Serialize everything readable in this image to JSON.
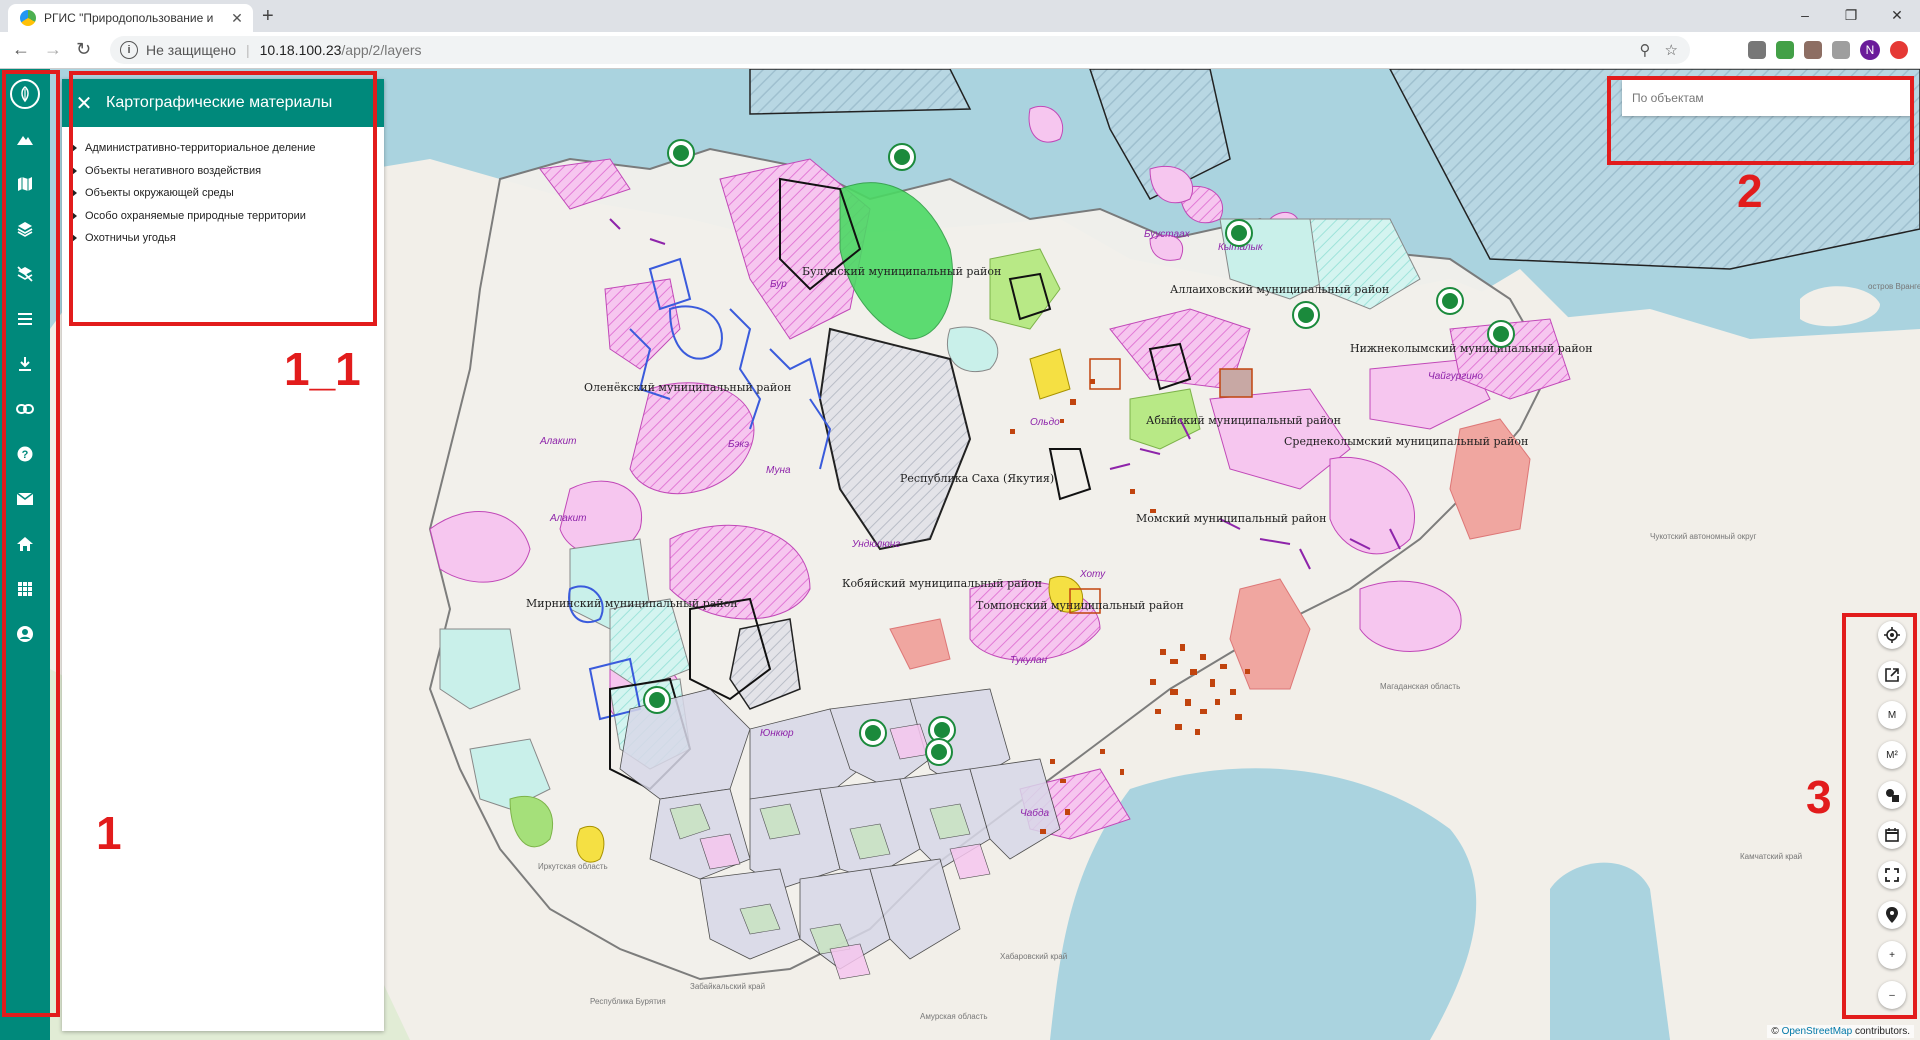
{
  "browser": {
    "tab_title": "РГИС \"Природопользование и",
    "tab_close": "✕",
    "new_tab": "+",
    "security_label": "Не защищено",
    "url_host": "10.18.100.23",
    "url_path": "/app/2/layers",
    "avatar_letter": "N",
    "window_controls": [
      "–",
      "❐",
      "✕"
    ]
  },
  "panel": {
    "title": "Картографические материалы",
    "close_glyph": "✕",
    "layers": [
      "Административно-территориальное деление",
      "Объекты негативного воздействия",
      "Объекты окружающей среды",
      "Особо охраняемые природные территории",
      "Охотничьи угодья"
    ]
  },
  "search": {
    "placeholder": "По объектам"
  },
  "rail": {
    "icons": [
      "logo-icon",
      "mountains-icon",
      "map-icon",
      "layers-icon",
      "layers-off-icon",
      "list-icon",
      "download-icon",
      "link-icon",
      "help-icon",
      "mail-icon",
      "home-icon",
      "apps-icon",
      "account-icon"
    ]
  },
  "map_tools": {
    "measure_length": "М",
    "measure_area": "М²",
    "zoom_in": "+",
    "zoom_out": "–",
    "icons": [
      "locate-icon",
      "open-external-icon",
      "measure-length-icon",
      "measure-area-icon",
      "shapes-icon",
      "calendar-icon",
      "fullscreen-icon",
      "marker-icon",
      "zoom-in-icon",
      "zoom-out-icon"
    ]
  },
  "map_labels": {
    "bulun": "Булунский муниципальный район",
    "allaikh": "Аллаиховский муниципальный район",
    "nizhnekolym": "Нижнеколымский муниципальный район",
    "olenek": "Оленёкский муниципальный район",
    "abyi": "Абыйский муниципальный район",
    "srednekolym": "Среднеколымский муниципальный район",
    "sakha": "Республика Саха (Якутия)",
    "mom": "Момский муниципальный район",
    "kobyai": "Кобяйский муниципальный район",
    "tompon": "Томпонский муниципальный район",
    "mirny": "Мирнинский муниципальный район",
    "bur": "Бур",
    "buustaah": "Буустаах",
    "kytalyk": "Кыталык",
    "chaygurgino": "Чайгургино",
    "alakit1": "Алакит",
    "alakit2": "Алакит",
    "bek": "Бэкэ",
    "muna": "Муна",
    "olgo": "Ольдо",
    "undulung": "Ундюлюнг",
    "khotu": "Хоту",
    "tuklan": "Тукулан",
    "yunyuskey": "Юнкюр",
    "chyrk": "Чабда",
    "vrangel": "остров Врангеля",
    "chukot": "Чукотский автономный округ",
    "magadan": "Магаданская область",
    "kamchatka": "Камчатский край",
    "irkutsk": "Иркутская область",
    "khabarovsk": "Хабаровский край",
    "amur": "Амурская область",
    "zabaikal": "Забайкальский край",
    "buryatia": "Республика Бурятия"
  },
  "attribution": {
    "prefix": "©",
    "link": "OpenStreetMap",
    "suffix": "contributors."
  },
  "annotations": {
    "label_1": "1",
    "label_1_1": "1_1",
    "label_2": "2",
    "label_3": "3"
  },
  "colors": {
    "brand": "#00897b",
    "annotation": "#e21c1c",
    "ocean": "#aad3df",
    "land": "#f2efe9"
  }
}
